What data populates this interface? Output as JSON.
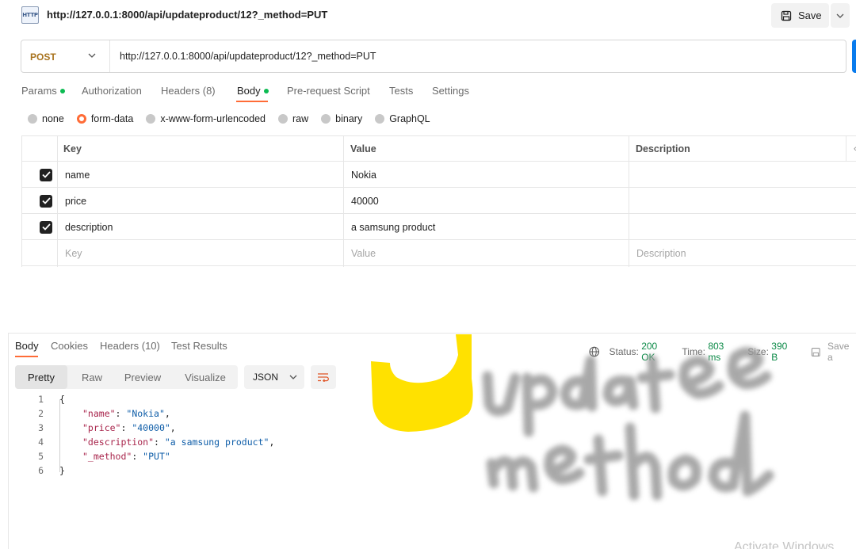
{
  "title": "http://127.0.0.1:8000/api/updateproduct/12?_method=PUT",
  "http_icon_label": "HTTP",
  "save": {
    "label": "Save"
  },
  "request": {
    "method": "POST",
    "url": "http://127.0.0.1:8000/api/updateproduct/12?_method=PUT"
  },
  "tabs": {
    "params": "Params",
    "authorization": "Authorization",
    "headers": "Headers (8)",
    "body": "Body",
    "prerequest": "Pre-request Script",
    "tests": "Tests",
    "settings": "Settings"
  },
  "body_types": [
    "none",
    "form-data",
    "x-www-form-urlencoded",
    "raw",
    "binary",
    "GraphQL"
  ],
  "form": {
    "headers": {
      "key": "Key",
      "value": "Value",
      "description": "Description"
    },
    "rows": [
      {
        "key": "name",
        "value": "Nokia",
        "description": ""
      },
      {
        "key": "price",
        "value": "40000",
        "description": ""
      },
      {
        "key": "description",
        "value": "a samsung product",
        "description": ""
      }
    ],
    "placeholders": {
      "key": "Key",
      "value": "Value",
      "description": "Description"
    }
  },
  "response": {
    "tabs": {
      "body": "Body",
      "cookies": "Cookies",
      "headers": "Headers (10)",
      "tests": "Test Results"
    },
    "status_label": "Status:",
    "status_value": "200 OK",
    "time_label": "Time:",
    "time_value": "803 ms",
    "size_label": "Size:",
    "size_value": "390 B",
    "save_label": "Save a",
    "views": [
      "Pretty",
      "Raw",
      "Preview",
      "Visualize"
    ],
    "format": "JSON",
    "code": {
      "line_numbers": [
        "1",
        "2",
        "3",
        "4",
        "5",
        "6"
      ],
      "open": "{",
      "close": "}",
      "lines": [
        {
          "key": "\"name\"",
          "value": "\"Nokia\"",
          "comma": ","
        },
        {
          "key": "\"price\"",
          "value": "\"40000\"",
          "comma": ","
        },
        {
          "key": "\"description\"",
          "value": "\"a samsung product\"",
          "comma": ","
        },
        {
          "key": "\"_method\"",
          "value": "\"PUT\"",
          "comma": ""
        }
      ]
    }
  },
  "handwriting": "update method",
  "watermark": "Activate Windows",
  "colors": {
    "accent": "#ff6c37",
    "method": "#a8731e",
    "status_ok": "#0b8a47",
    "send": "#097bed",
    "highlight": "#ffe100"
  }
}
